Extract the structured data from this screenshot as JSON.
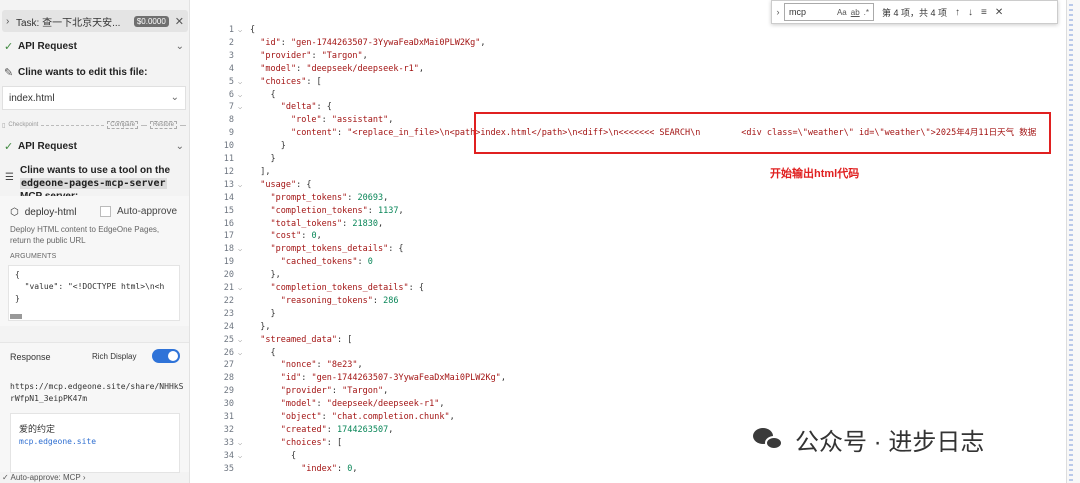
{
  "left_panel": {
    "task_title": "Task: 查一下北京天安...",
    "task_cost": "$0.0000",
    "api_request_1": "API Request",
    "edit_text": "Cline wants to edit this file:",
    "file_select": "index.html",
    "checkpoint_label": "Checkpoint",
    "compare_btn": "Compare",
    "restore_btn": "Restore",
    "api_request_2": "API Request",
    "mcp_pre": "Cline wants to use a tool on the ",
    "mcp_server": "edgeone-pages-mcp-server",
    "mcp_post": " MCP server:",
    "tool_name": "deploy-html",
    "auto_approve": "Auto-approve",
    "tool_desc": "Deploy HTML content to EdgeOne Pages, return the public URL",
    "args_label": "ARGUMENTS",
    "args_code": "{\n  \"value\": \"<!DOCTYPE html>\\n<h\n}",
    "response_label": "Response",
    "rich_display": "Rich Display",
    "response_url": "https://mcp.edgeone.site/share/NHHkSrWfpN1_3eipPK47m",
    "resp_title": "爱的约定",
    "resp_link": "mcp.edgeone.site",
    "footer": "Auto-approve: MCP"
  },
  "find": {
    "query": "mcp",
    "opt_case": "Aa",
    "opt_word": "ab",
    "opt_regex": ".*",
    "count": "第 4 项，共 4 项",
    "up": "↑",
    "down": "↓",
    "menu": "≡",
    "close": "✕"
  },
  "annotation": "开始输出html代码",
  "watermark": "公众号 · 进步日志",
  "code_lines": [
    {
      "n": "1",
      "fold": true,
      "html": "<span class='p'>{</span>"
    },
    {
      "n": "2",
      "fold": false,
      "html": "  <span class='k'>\"id\"</span><span class='p'>: </span><span class='s'>\"gen-1744263507-3YywaFeaDxMai0PLW2Kg\"</span><span class='p'>,</span>"
    },
    {
      "n": "3",
      "fold": false,
      "html": "  <span class='k'>\"provider\"</span><span class='p'>: </span><span class='s'>\"Targon\"</span><span class='p'>,</span>"
    },
    {
      "n": "4",
      "fold": false,
      "html": "  <span class='k'>\"model\"</span><span class='p'>: </span><span class='s'>\"deepseek/deepseek-r1\"</span><span class='p'>,</span>"
    },
    {
      "n": "5",
      "fold": true,
      "html": "  <span class='k'>\"choices\"</span><span class='p'>: [</span>"
    },
    {
      "n": "6",
      "fold": true,
      "html": "    <span class='p'>{</span>"
    },
    {
      "n": "7",
      "fold": true,
      "html": "      <span class='k'>\"delta\"</span><span class='p'>: {</span>"
    },
    {
      "n": "8",
      "fold": false,
      "html": "        <span class='k'>\"role\"</span><span class='p'>: </span><span class='s'>\"assistant\"</span><span class='p'>,</span>"
    },
    {
      "n": "9",
      "fold": false,
      "html": "        <span class='k'>\"content\"</span><span class='p'>: </span><span class='s'>\"&lt;replace_in_file&gt;\\n&lt;path&gt;index.html&lt;/path&gt;\\n&lt;diff&gt;\\n&lt;&lt;&lt;&lt;&lt;&lt;&lt; SEARCH\\n        &lt;div class=\\\"weather\\\" id=\\\"weather\\\"&gt;2025年4月11日天气 数据</span>"
    },
    {
      "n": "10",
      "fold": false,
      "html": "      <span class='p'>}</span>"
    },
    {
      "n": "11",
      "fold": false,
      "html": "    <span class='p'>}</span>"
    },
    {
      "n": "12",
      "fold": false,
      "html": "  <span class='p'>],</span>"
    },
    {
      "n": "13",
      "fold": true,
      "html": "  <span class='k'>\"usage\"</span><span class='p'>: {</span>"
    },
    {
      "n": "14",
      "fold": false,
      "html": "    <span class='k'>\"prompt_tokens\"</span><span class='p'>: </span><span class='n'>20693</span><span class='p'>,</span>"
    },
    {
      "n": "15",
      "fold": false,
      "html": "    <span class='k'>\"completion_tokens\"</span><span class='p'>: </span><span class='n'>1137</span><span class='p'>,</span>"
    },
    {
      "n": "16",
      "fold": false,
      "html": "    <span class='k'>\"total_tokens\"</span><span class='p'>: </span><span class='n'>21830</span><span class='p'>,</span>"
    },
    {
      "n": "17",
      "fold": false,
      "html": "    <span class='k'>\"cost\"</span><span class='p'>: </span><span class='n'>0</span><span class='p'>,</span>"
    },
    {
      "n": "18",
      "fold": true,
      "html": "    <span class='k'>\"prompt_tokens_details\"</span><span class='p'>: {</span>"
    },
    {
      "n": "19",
      "fold": false,
      "html": "      <span class='k'>\"cached_tokens\"</span><span class='p'>: </span><span class='n'>0</span>"
    },
    {
      "n": "20",
      "fold": false,
      "html": "    <span class='p'>},</span>"
    },
    {
      "n": "21",
      "fold": true,
      "html": "    <span class='k'>\"completion_tokens_details\"</span><span class='p'>: {</span>"
    },
    {
      "n": "22",
      "fold": false,
      "html": "      <span class='k'>\"reasoning_tokens\"</span><span class='p'>: </span><span class='n'>286</span>"
    },
    {
      "n": "23",
      "fold": false,
      "html": "    <span class='p'>}</span>"
    },
    {
      "n": "24",
      "fold": false,
      "html": "  <span class='p'>},</span>"
    },
    {
      "n": "25",
      "fold": true,
      "html": "  <span class='k'>\"streamed_data\"</span><span class='p'>: [</span>"
    },
    {
      "n": "26",
      "fold": true,
      "html": "    <span class='p'>{</span>"
    },
    {
      "n": "27",
      "fold": false,
      "html": "      <span class='k'>\"nonce\"</span><span class='p'>: </span><span class='s'>\"8e23\"</span><span class='p'>,</span>"
    },
    {
      "n": "28",
      "fold": false,
      "html": "      <span class='k'>\"id\"</span><span class='p'>: </span><span class='s'>\"gen-1744263507-3YywaFeaDxMai0PLW2Kg\"</span><span class='p'>,</span>"
    },
    {
      "n": "29",
      "fold": false,
      "html": "      <span class='k'>\"provider\"</span><span class='p'>: </span><span class='s'>\"Targon\"</span><span class='p'>,</span>"
    },
    {
      "n": "30",
      "fold": false,
      "html": "      <span class='k'>\"model\"</span><span class='p'>: </span><span class='s'>\"deepseek/deepseek-r1\"</span><span class='p'>,</span>"
    },
    {
      "n": "31",
      "fold": false,
      "html": "      <span class='k'>\"object\"</span><span class='p'>: </span><span class='s'>\"chat.completion.chunk\"</span><span class='p'>,</span>"
    },
    {
      "n": "32",
      "fold": false,
      "html": "      <span class='k'>\"created\"</span><span class='p'>: </span><span class='n'>1744263507</span><span class='p'>,</span>"
    },
    {
      "n": "33",
      "fold": true,
      "html": "      <span class='k'>\"choices\"</span><span class='p'>: [</span>"
    },
    {
      "n": "34",
      "fold": true,
      "html": "        <span class='p'>{</span>"
    },
    {
      "n": "35",
      "fold": false,
      "html": "          <span class='k'>\"index\"</span><span class='p'>: </span><span class='n'>0</span><span class='p'>,</span>"
    }
  ]
}
